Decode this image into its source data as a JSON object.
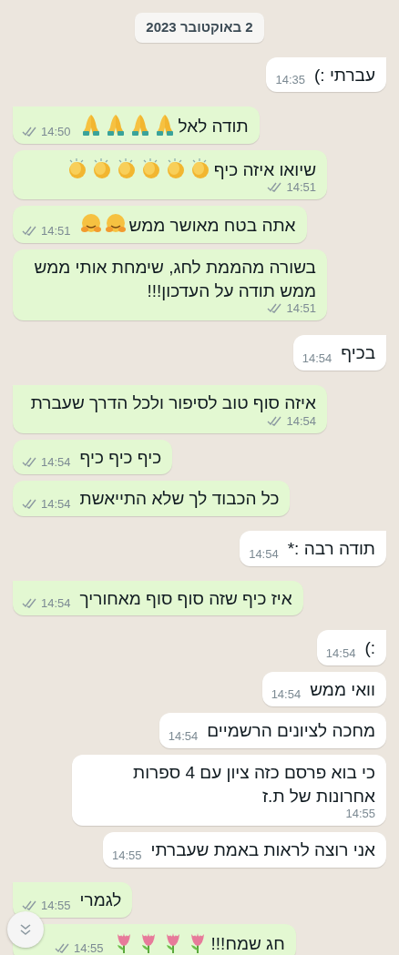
{
  "date_chip": "2 באוקטובר 2023",
  "messages": [
    {
      "kind": "received",
      "tail": true,
      "text": "עברתי :)",
      "time": "14:35"
    },
    {
      "kind": "sent",
      "tail": true,
      "text": "תודה לאל",
      "emojis": [
        {
          "kind": "pray"
        },
        {
          "kind": "pray"
        },
        {
          "kind": "pray"
        },
        {
          "kind": "pray"
        }
      ],
      "time": "14:50"
    },
    {
      "kind": "sent",
      "tail": false,
      "text": "שיואו איזה כיף",
      "emojis": [
        {
          "kind": "clap"
        },
        {
          "kind": "clap"
        },
        {
          "kind": "clap"
        },
        {
          "kind": "clap"
        },
        {
          "kind": "clap"
        },
        {
          "kind": "clap"
        }
      ],
      "time": "14:51"
    },
    {
      "kind": "sent",
      "tail": false,
      "text": "אתה בטח מאושר ממש",
      "emojis": [
        {
          "kind": "hug"
        },
        {
          "kind": "hug"
        }
      ],
      "time": "14:51"
    },
    {
      "kind": "sent",
      "tail": false,
      "text": "בשורה מהממת לחג, שימחת אותי ממש ממש תודה על העדכון!!!",
      "time": "14:51"
    },
    {
      "kind": "received",
      "tail": true,
      "text": "בכיף",
      "time": "14:54"
    },
    {
      "kind": "sent",
      "tail": true,
      "text": "איזה סוף טוב לסיפור ולכל הדרך שעברת",
      "time": "14:54"
    },
    {
      "kind": "sent",
      "tail": false,
      "text": "כיף כיף כיף",
      "time": "14:54"
    },
    {
      "kind": "sent",
      "tail": false,
      "text": "כל הכבוד לך שלא התייאשת",
      "time": "14:54"
    },
    {
      "kind": "received",
      "tail": true,
      "text": "תודה רבה :*",
      "time": "14:54"
    },
    {
      "kind": "sent",
      "tail": true,
      "text": "איז  כיף שזה סוף סוף מאחוריך",
      "time": "14:54"
    },
    {
      "kind": "received",
      "tail": true,
      "text": ":)",
      "time": "14:54"
    },
    {
      "kind": "received",
      "tail": false,
      "text": "וואי ממש",
      "time": "14:54"
    },
    {
      "kind": "received",
      "tail": false,
      "text": "מחכה לציונים הרשמיים",
      "time": "14:54"
    },
    {
      "kind": "received",
      "tail": false,
      "text": "כי בוא פרסם כזה ציון עם 4 ספרות אחרונות של ת.ז",
      "time": "14:55"
    },
    {
      "kind": "received",
      "tail": false,
      "text": "אני רוצה לראות באמת שעברתי",
      "time": "14:55"
    },
    {
      "kind": "sent",
      "tail": true,
      "text": "לגמרי",
      "time": "14:55"
    },
    {
      "kind": "sent",
      "tail": false,
      "text": "חג שמח!!!",
      "emojis": [
        {
          "kind": "tulip"
        },
        {
          "kind": "tulip"
        },
        {
          "kind": "tulip"
        },
        {
          "kind": "tulip"
        }
      ],
      "time": "14:55"
    }
  ]
}
